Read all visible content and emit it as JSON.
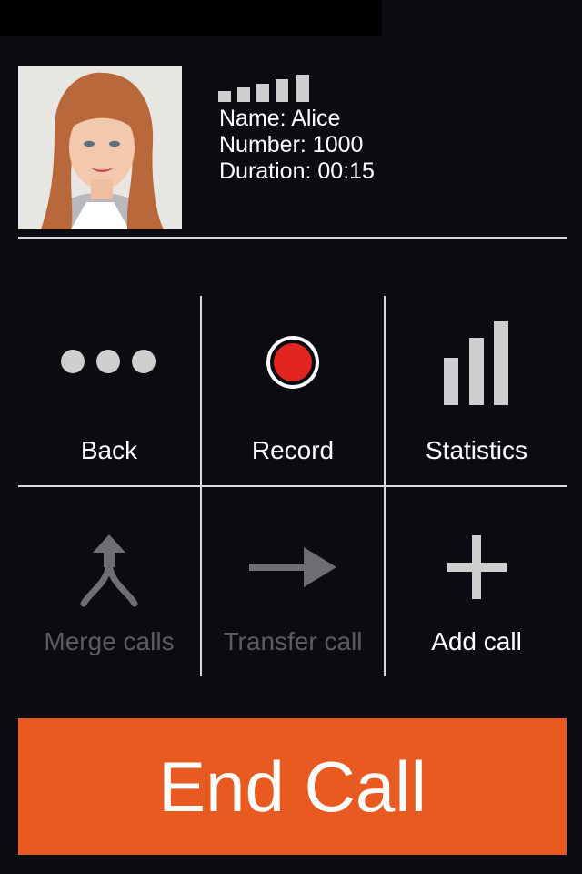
{
  "caller": {
    "name_line": "Name: Alice",
    "number_line": "Number: 1000",
    "duration_line": "Duration: 00:15",
    "signal_strength": 5
  },
  "actions": [
    {
      "label": "Back",
      "icon": "more-dots-icon",
      "enabled": true
    },
    {
      "label": "Record",
      "icon": "record-icon",
      "enabled": true
    },
    {
      "label": "Statistics",
      "icon": "bar-chart-icon",
      "enabled": true
    },
    {
      "label": "Merge calls",
      "icon": "merge-icon",
      "enabled": false
    },
    {
      "label": "Transfer call",
      "icon": "arrow-right-icon",
      "enabled": false
    },
    {
      "label": "Add call",
      "icon": "plus-icon",
      "enabled": true
    }
  ],
  "end_call": {
    "label": "End Call"
  },
  "colors": {
    "background": "#0b0b12",
    "end_call": "#e85a1f",
    "record_red": "#e0261f",
    "disabled_text": "#5b5b61",
    "icon_gray": "#cfcfcf"
  }
}
